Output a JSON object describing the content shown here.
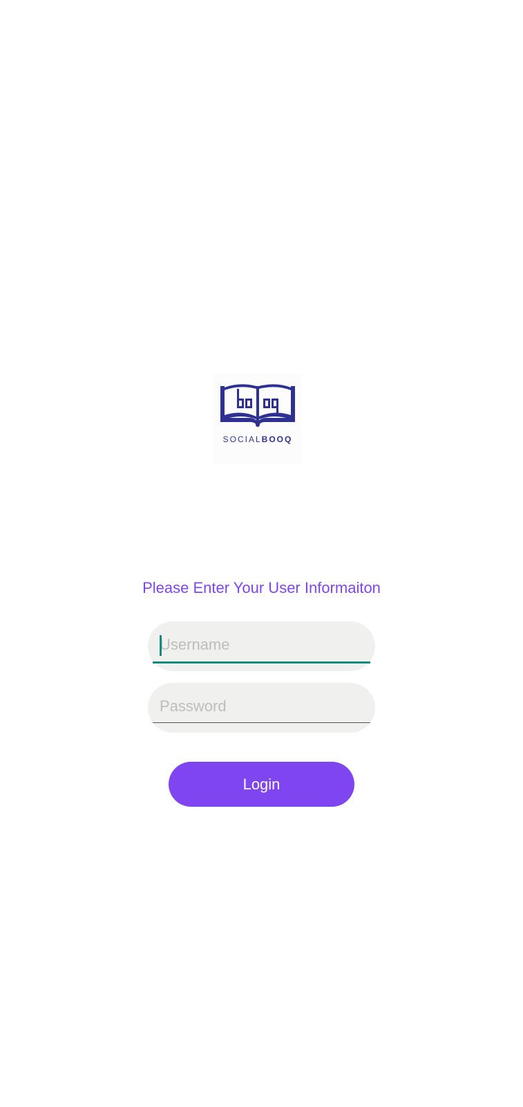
{
  "logo": {
    "wordmark_light": "SOCIAL",
    "wordmark_bold": "BOOQ",
    "brand_color": "#2e3192"
  },
  "prompt": {
    "text": "Please Enter Your User Informaiton"
  },
  "form": {
    "username": {
      "placeholder": "Username",
      "value": ""
    },
    "password": {
      "placeholder": "Password",
      "value": ""
    },
    "login_label": "Login"
  },
  "colors": {
    "accent": "#7f45f0",
    "focus": "#128a7e",
    "field_background": "#f0f0ef",
    "placeholder": "#bdbdbd"
  }
}
